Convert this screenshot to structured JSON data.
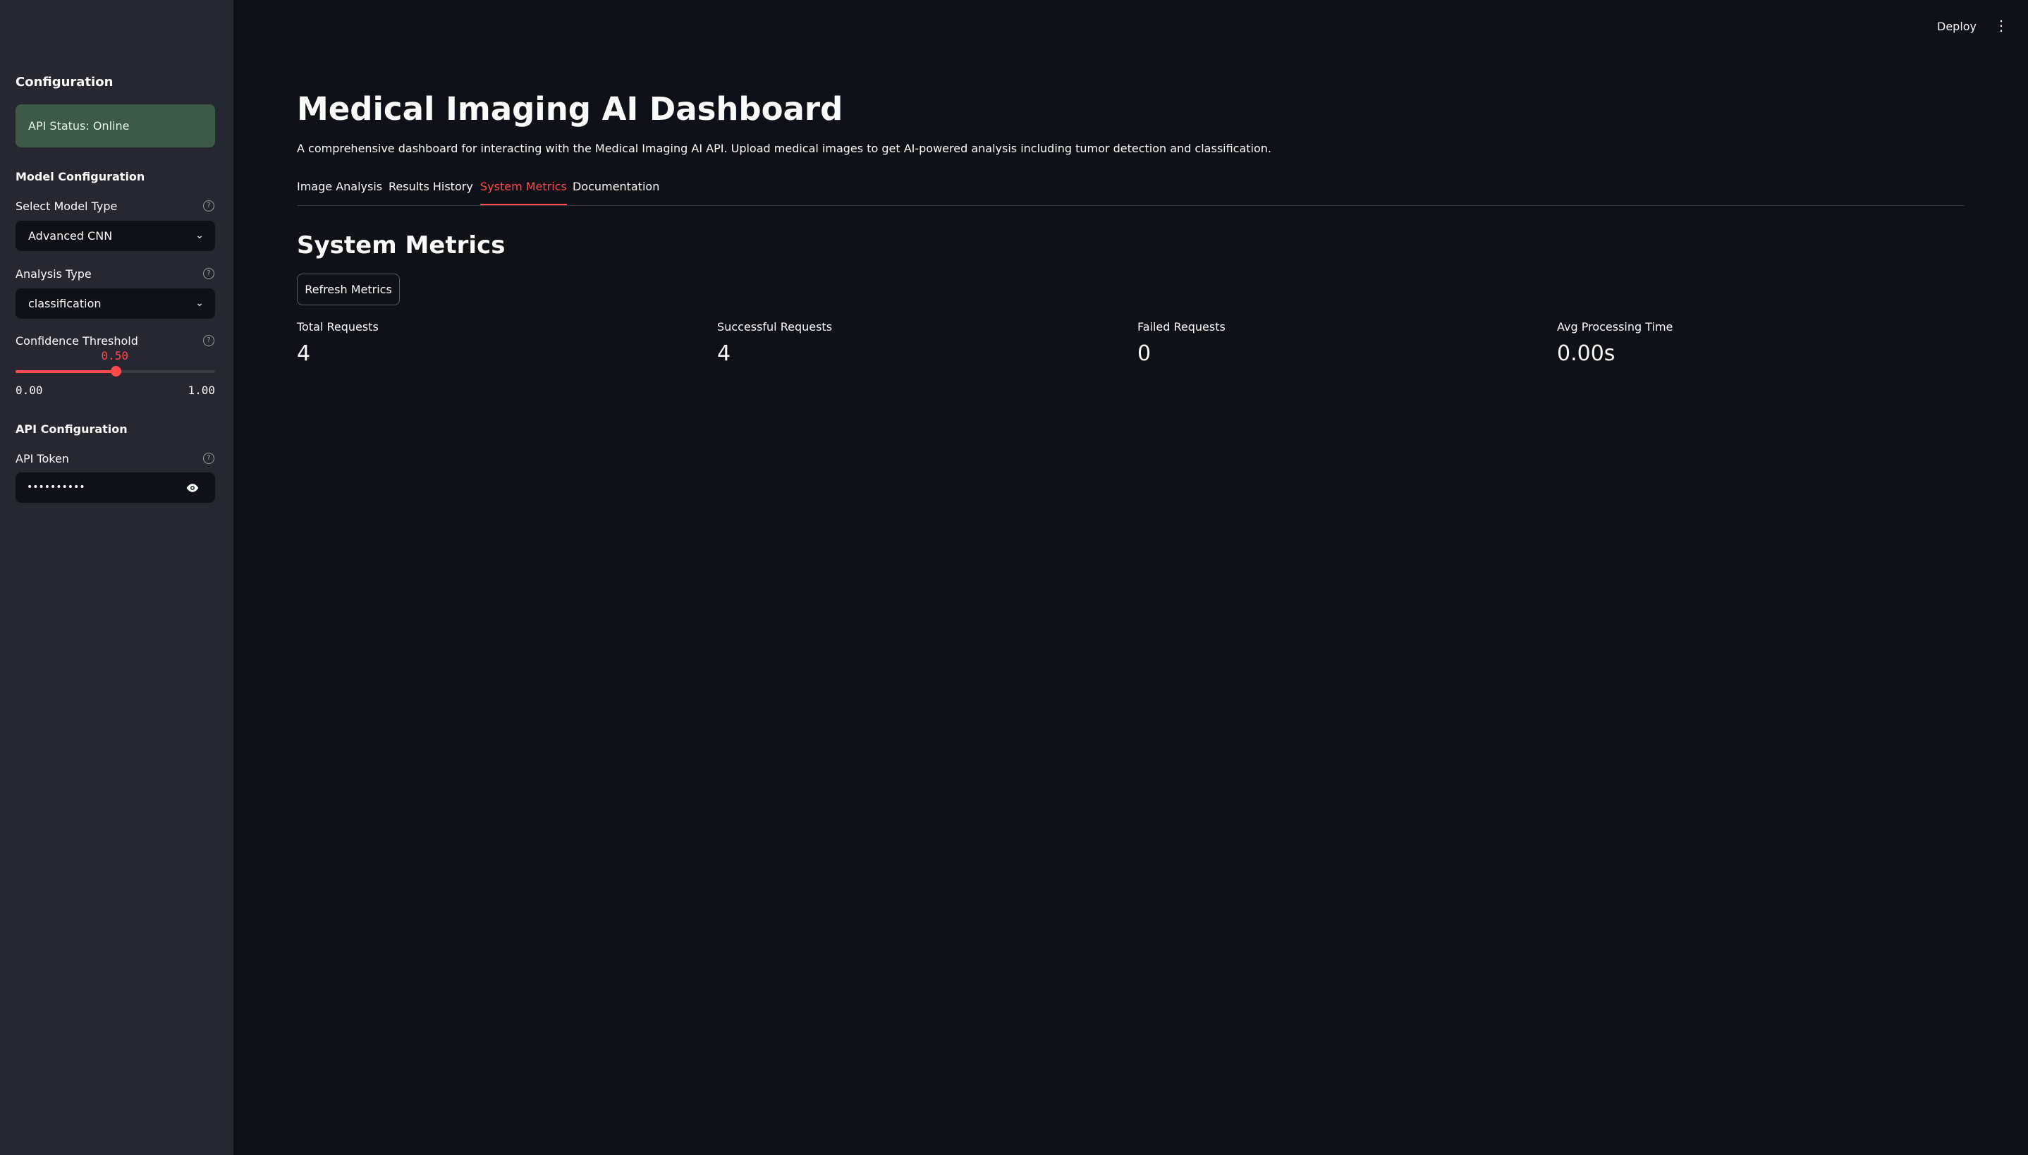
{
  "sidebar": {
    "title": "Configuration",
    "api_status": "API Status: Online",
    "model_config_heading": "Model Configuration",
    "model_type_label": "Select Model Type",
    "model_type_value": "Advanced CNN",
    "analysis_type_label": "Analysis Type",
    "analysis_type_value": "classification",
    "confidence_label": "Confidence Threshold",
    "confidence": {
      "value": "0.50",
      "min": "0.00",
      "max": "1.00",
      "fraction": 0.5
    },
    "api_config_heading": "API Configuration",
    "api_token_label": "API Token",
    "api_token_value": "••••••••••"
  },
  "header": {
    "deploy_label": "Deploy",
    "menu_icon": "vertical-dots-icon"
  },
  "main": {
    "title": "Medical Imaging AI Dashboard",
    "description": "A comprehensive dashboard for interacting with the Medical Imaging AI API. Upload medical images to get AI-powered analysis including tumor detection and classification.",
    "tabs": [
      {
        "label": "Image Analysis",
        "active": false
      },
      {
        "label": "Results History",
        "active": false
      },
      {
        "label": "System Metrics",
        "active": true
      },
      {
        "label": "Documentation",
        "active": false
      }
    ],
    "section_title": "System Metrics",
    "refresh_label": "Refresh Metrics",
    "metrics": [
      {
        "label": "Total Requests",
        "value": "4"
      },
      {
        "label": "Successful Requests",
        "value": "4"
      },
      {
        "label": "Failed Requests",
        "value": "0"
      },
      {
        "label": "Avg Processing Time",
        "value": "0.00s"
      }
    ]
  },
  "colors": {
    "accent": "#ff4b4b",
    "background": "#0e1117",
    "sidebar": "#262730",
    "status_bg": "#3d5a48"
  }
}
